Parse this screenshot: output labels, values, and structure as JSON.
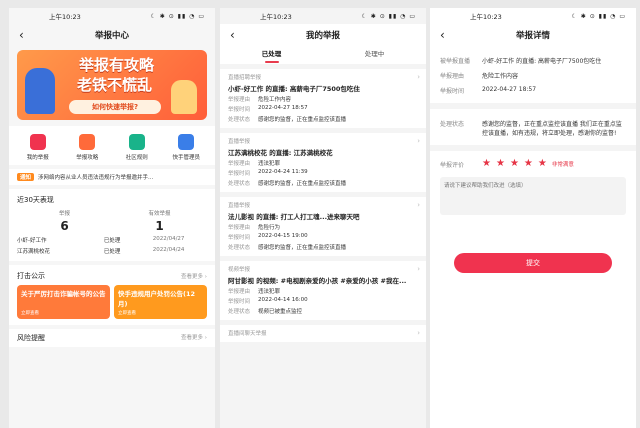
{
  "statusbar": {
    "time": "上午10:23",
    "icons": "☾ ✱ ⊙ ▮▮ ◔ ▭"
  },
  "center": {
    "title": "举报中心",
    "banner": {
      "line1": "举报有攻略",
      "line2": "老铁不慌乱",
      "cta": "如何快速举报?"
    },
    "quick": [
      {
        "label": "我的举报",
        "color": "#f0334f"
      },
      {
        "label": "举报攻略",
        "color": "#ff6a3a"
      },
      {
        "label": "社区规则",
        "color": "#19b38a"
      },
      {
        "label": "快手管理员",
        "color": "#3a7ee8"
      }
    ],
    "notice": {
      "tag": "通知",
      "text": "涉网络内容从业人员违法违规行为举报邀并手..."
    },
    "stats": {
      "title": "近30天表现",
      "reported_label": "举报",
      "reported_value": "6",
      "valid_label": "有效举报",
      "valid_value": "1",
      "records": [
        {
          "name": "小虾-好工作",
          "status": "已处理",
          "date": "2022/04/27"
        },
        {
          "name": "江苏满桃校花",
          "status": "已处理",
          "date": "2022/04/24"
        }
      ]
    },
    "strike": {
      "title": "打击公示",
      "more": "查看更多 ›",
      "cards": [
        {
          "title": "关于严厉打击诈骗帐号的公告",
          "sub": "立即查看",
          "color": "#ff7a3a"
        },
        {
          "title": "快手违规用户处罚公告(12月)",
          "sub": "立即查看",
          "color": "#ff9a1e"
        }
      ]
    },
    "risk": {
      "title": "风险提醒",
      "more": "查看更多 ›"
    }
  },
  "mine": {
    "title": "我的举报",
    "tabs": [
      "已处理",
      "处理中"
    ],
    "keys": {
      "reason": "举报理由",
      "time": "举报时间",
      "status": "处理状态"
    },
    "items": [
      {
        "category": "直播招聘举报",
        "title": "小虾-好工作 的直播: 高薪电子厂7500包吃住",
        "reason": "危险工作内容",
        "time": "2022-04-27 18:57",
        "status": "感谢您的监督，正在重点监控该直播"
      },
      {
        "category": "直播举报",
        "title": "江苏满桃校花 的直播: 江苏满桃校花",
        "reason": "违法犯罪",
        "time": "2022-04-24 11:39",
        "status": "感谢您的监督，正在重点监控该直播"
      },
      {
        "category": "直播举报",
        "title": "法儿影视 的直播: 打工人打工魂...进来聊天吧",
        "reason": "危险行为",
        "time": "2022-04-15 19:00",
        "status": "感谢您的监督，正在重点监控该直播"
      },
      {
        "category": "视频举报",
        "title": "阿甘影视 的视频: #电视剧亲爱的小孩 #亲爱的小孩 #我在...",
        "reason": "违法犯罪",
        "time": "2022-04-14 16:00",
        "status": "视频已被重点监控"
      },
      {
        "category": "直播间聊天举报",
        "title": "",
        "reason": "",
        "time": "",
        "status": ""
      }
    ]
  },
  "detail": {
    "title": "举报详情",
    "rows": [
      {
        "k": "被举报直播",
        "v": "小虾-好工作 的直播: 高薪电子厂7500包吃住"
      },
      {
        "k": "举报理由",
        "v": "危险工作内容"
      },
      {
        "k": "举报时间",
        "v": "2022-04-27 18:57"
      }
    ],
    "process": {
      "k": "处理状态",
      "v": "感谢您的监督，正在重点监控该直播 我们正在重点监控该直播，如有违规，将立即处理，感谢你的监督!"
    },
    "rating": {
      "k": "举报评价",
      "stars": 5,
      "label": "非常满意"
    },
    "comment_placeholder": "请说下建议帮助我们改进（选填）",
    "submit": "提交"
  }
}
